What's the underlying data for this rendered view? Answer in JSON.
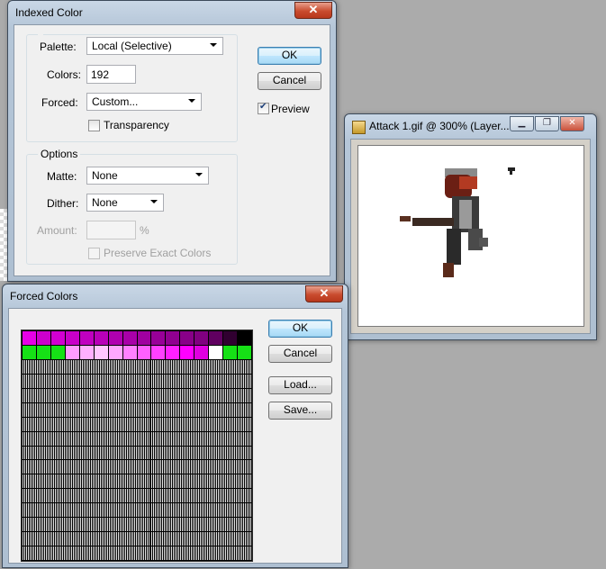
{
  "indexed_color": {
    "title": "Indexed Color",
    "palette_label": "Palette:",
    "palette_value": "Local (Selective)",
    "colors_label": "Colors:",
    "colors_value": "192",
    "forced_label": "Forced:",
    "forced_value": "Custom...",
    "transparency_label": "Transparency",
    "transparency_checked": false,
    "options_legend": "Options",
    "matte_label": "Matte:",
    "matte_value": "None",
    "dither_label": "Dither:",
    "dither_value": "None",
    "amount_label": "Amount:",
    "amount_value": "",
    "amount_unit": "%",
    "preserve_label": "Preserve Exact Colors",
    "ok_label": "OK",
    "cancel_label": "Cancel",
    "preview_label": "Preview",
    "preview_checked": true
  },
  "forced_colors": {
    "title": "Forced Colors",
    "ok_label": "OK",
    "cancel_label": "Cancel",
    "load_label": "Load...",
    "save_label": "Save...",
    "row1_colors": [
      "#e600e6",
      "#cc00cc",
      "#d200d2",
      "#c800c8",
      "#c000c0",
      "#b800b8",
      "#b000b0",
      "#a800a8",
      "#a000a0",
      "#980098",
      "#900090",
      "#880088",
      "#800080",
      "#600060",
      "#300030",
      "#000000"
    ],
    "row2_colors": [
      "#16e016",
      "#16e016",
      "#16e016",
      "#ff9cff",
      "#ffb0ff",
      "#ffc6ff",
      "#ffa8ff",
      "#ff80ff",
      "#ff60ff",
      "#ff40ff",
      "#ff20ff",
      "#ff00ff",
      "#e000e0",
      "#ffffff",
      "#16e016",
      "#16e016"
    ]
  },
  "doc_window": {
    "title": "Attack 1.gif @ 300% (Layer...",
    "minimize_icon": "minimize-icon",
    "restore_icon": "restore-icon",
    "close_icon": "close-icon"
  },
  "close_glyph": "✕"
}
